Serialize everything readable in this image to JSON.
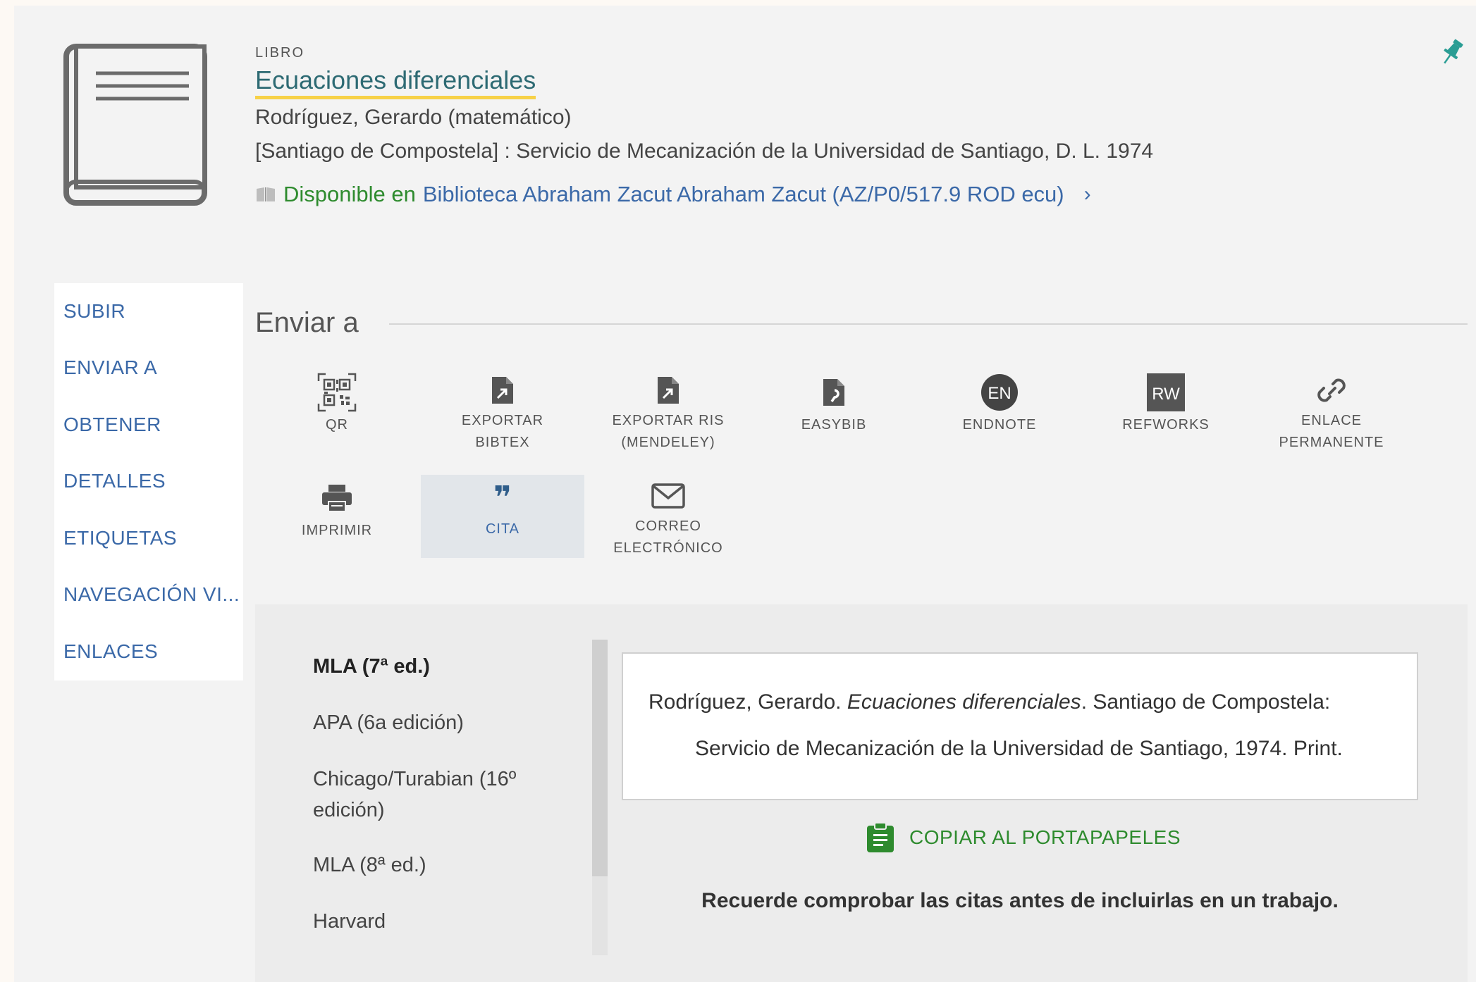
{
  "record": {
    "type": "LIBRO",
    "title": "Ecuaciones diferenciales",
    "author": "Rodríguez, Gerardo (matemático)",
    "publication": "[Santiago de Compostela] : Servicio de Mecanización de la Universidad de Santiago, D. L. 1974",
    "availability": {
      "status": "Disponible en",
      "location": "Biblioteca Abraham Zacut  Abraham Zacut (AZ/P0/517.9 ROD ecu)",
      "chevron": "›"
    }
  },
  "nav": {
    "items": [
      {
        "label": "SUBIR"
      },
      {
        "label": "ENVIAR A"
      },
      {
        "label": "OBTENER"
      },
      {
        "label": "DETALLES"
      },
      {
        "label": "ETIQUETAS"
      },
      {
        "label": "NAVEGACIÓN VI..."
      },
      {
        "label": "ENLACES"
      }
    ]
  },
  "send_to": {
    "title": "Enviar a",
    "actions": [
      {
        "label": "QR",
        "icon": "qr-code-icon"
      },
      {
        "label": "EXPORTAR BIBTEX",
        "icon": "file-export-icon"
      },
      {
        "label": "EXPORTAR RIS (MENDELEY)",
        "icon": "file-export-icon"
      },
      {
        "label": "EASYBIB",
        "icon": "easybib-icon"
      },
      {
        "label": "ENDNOTE",
        "icon": "endnote-icon",
        "badge": "EN"
      },
      {
        "label": "REFWORKS",
        "icon": "refworks-icon",
        "badge": "RW"
      },
      {
        "label": "ENLACE PERMANENTE",
        "icon": "link-icon"
      },
      {
        "label": "IMPRIMIR",
        "icon": "printer-icon"
      },
      {
        "label": "CITA",
        "icon": "quote-icon",
        "glyph": "❞"
      },
      {
        "label": "CORREO ELECTRÓNICO",
        "icon": "envelope-icon"
      }
    ]
  },
  "citation": {
    "styles": [
      {
        "label": "MLA (7ª ed.)",
        "selected": true
      },
      {
        "label": "APA (6a edición)"
      },
      {
        "label": "Chicago/Turabian (16º edición)"
      },
      {
        "label": "MLA (8ª ed.)"
      },
      {
        "label": "Harvard"
      }
    ],
    "text": {
      "author": "Rodríguez, Gerardo. ",
      "title": "Ecuaciones diferenciales",
      "rest_line1": ". Santiago de Compostela:",
      "line2": "Servicio de Mecanización de la Universidad de Santiago, 1974. Print."
    },
    "copy_label": "COPIAR AL PORTAPAPELES",
    "reminder": "Recuerde comprobar las citas antes de incluirlas en un trabajo."
  },
  "colors": {
    "link": "#3b69a8",
    "title": "#2d6a73",
    "title_underline": "#f7d147",
    "available": "#2e8b2e",
    "pin": "#2a9d94"
  }
}
